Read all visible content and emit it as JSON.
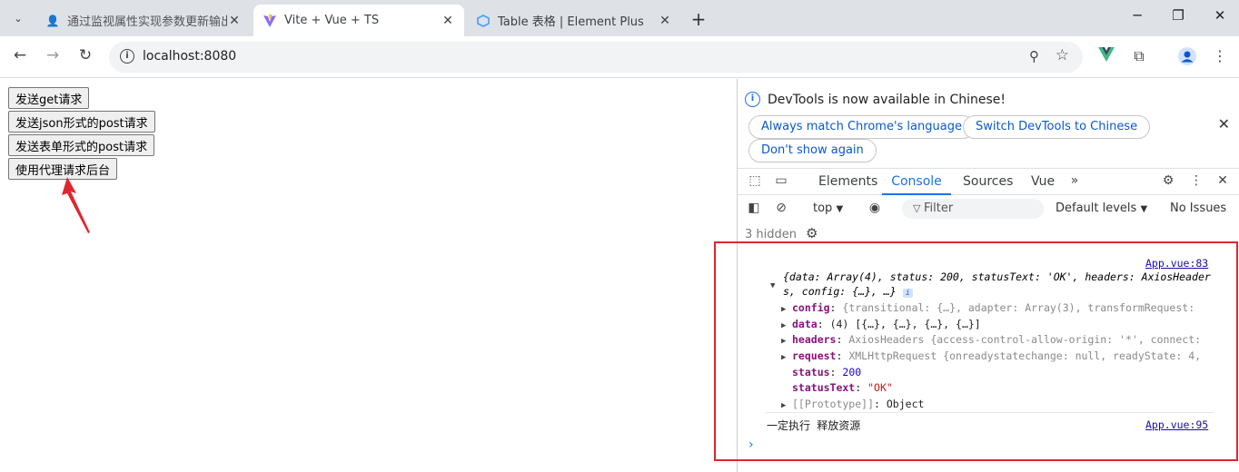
{
  "browser": {
    "tabs": [
      {
        "title": "通过监视属性实现参数更新输出",
        "active": false
      },
      {
        "title": "Vite + Vue + TS",
        "active": true
      },
      {
        "title": "Table 表格 | Element Plus",
        "active": false
      }
    ],
    "url": "localhost:8080"
  },
  "page": {
    "buttons": [
      "发送get请求",
      "发送json形式的post请求",
      "发送表单形式的post请求",
      "使用代理请求后台"
    ]
  },
  "devtools": {
    "info_text": "DevTools is now available in Chinese!",
    "pills": [
      "Always match Chrome's language",
      "Switch DevTools to Chinese",
      "Don't show again"
    ],
    "tabs": [
      "Elements",
      "Console",
      "Sources",
      "Vue"
    ],
    "active_tab": "Console",
    "context": "top",
    "filter_placeholder": "Filter",
    "levels": "Default levels",
    "issues": "No Issues",
    "hidden": "3 hidden",
    "log": {
      "source1": "App.vue:83",
      "source2": "App.vue:95",
      "summary_1": "{data: Array(4), status: 200, statusText: 'OK', headers: AxiosHeader",
      "summary_2": "s, config: {…}, …}",
      "config": "config",
      "config_val": "{transitional: {…}, adapter: Array(3), transformRequest:",
      "data": "data",
      "data_val": "(4) [{…}, {…}, {…}, {…}]",
      "headers": "headers",
      "headers_val": "AxiosHeaders {access-control-allow-origin: '*', connect:",
      "request": "request",
      "request_val": "XMLHttpRequest {onreadystatechange: null, readyState: 4,",
      "status": "status",
      "status_val": "200",
      "statusText": "statusText",
      "statusText_val": "\"OK\"",
      "prototype": "[[Prototype]]",
      "prototype_val": "Object",
      "message2": "一定执行  释放资源"
    }
  },
  "colors": {
    "highlight": "#e0262d",
    "accent": "#1a73e8"
  }
}
